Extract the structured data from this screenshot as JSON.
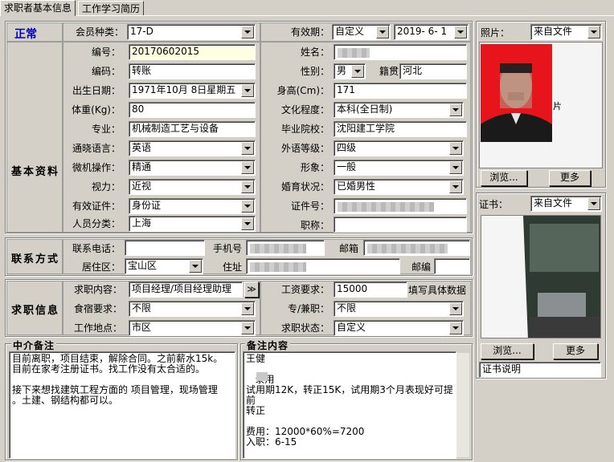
{
  "tabs": [
    "求职者基本信息",
    "工作学习简历"
  ],
  "status": "正常",
  "member_type": {
    "label": "会员种类：",
    "value": "17-D"
  },
  "validity": {
    "label": "有效期：",
    "mode": "自定义",
    "date": "2019- 6- 1"
  },
  "sections": {
    "basic": "基本资料",
    "contact": "联系方式",
    "job": "求职信息"
  },
  "basic": {
    "number_label": "编号：",
    "number": "20170602015",
    "name_label": "姓名：",
    "name": "",
    "code_label": "编码：",
    "code": "转账",
    "gender_label": "性别：",
    "gender": "男",
    "native_label": "籍贯",
    "native": "河北",
    "birth_label": "出生日期：",
    "birth": "1971年10月 8日星期五",
    "height_label": "身高(Cm)：",
    "height": "171",
    "weight_label": "体重(Kg)：",
    "weight": "80",
    "edu_label": "文化程度：",
    "edu": "本科(全日制)",
    "major_label": "专业：",
    "major": "机械制造工艺与设备",
    "school_label": "毕业院校：",
    "school": "沈阳建工学院",
    "lang_label": "通晓语言：",
    "lang": "英语",
    "lang_level_label": "外语等级：",
    "lang_level": "四级",
    "computer_label": "微机操作：",
    "computer": "精通",
    "image_label": "形象：",
    "image": "一般",
    "vision_label": "视力：",
    "vision": "近视",
    "marital_label": "婚育状况：",
    "marital": "已婚男性",
    "id_type_label": "有效证件：",
    "id_type": "身份证",
    "id_no_label": "证件号：",
    "id_no": "",
    "category_label": "人员分类：",
    "category": "上海",
    "title_label": "职称：",
    "title": ""
  },
  "contact": {
    "phone_label": "联系电话：",
    "phone": "",
    "mobile_label": "手机号",
    "mobile": "",
    "email_label": "邮箱",
    "email": "",
    "district_label": "居住区：",
    "district": "宝山区",
    "address_label": "住址",
    "address": "",
    "zip_label": "邮编",
    "zip": ""
  },
  "job": {
    "content_label": "求职内容：",
    "content": "项目经理/项目经理助理",
    "more_btn": "≫",
    "salary_label": "工资要求：",
    "salary": "15000",
    "salary_hint": "填写具体数据",
    "board_label": "食宿要求：",
    "board": "不限",
    "parttime_label": "专/兼职：",
    "parttime": "不限",
    "location_label": "工作地点：",
    "location": "市区",
    "state_label": "求职状态：",
    "state": "自定义"
  },
  "agent_note": {
    "title": "中介备注",
    "text": "目前离职，项目结束，解除合同。之前薪水15k。\n目前在家考注册证书。找工作没有太合适的。\n\n接下来想找建筑工程方面的 项目管理，现场管理\n。土建、钢结构都可以。"
  },
  "remarks": {
    "title": "备注内容",
    "text": "王健\n\n   录用\n试用期12K，转正15K，试用期3个月表现好可提前\n转正\n\n费用：12000*60%=7200\n入职：6-15"
  },
  "photo": {
    "label": "照片：",
    "source": "来自文件",
    "browse": "浏览...",
    "more": "更多"
  },
  "cert": {
    "label": "证书：",
    "source": "来自文件",
    "browse": "浏览...",
    "more": "更多",
    "desc": "证书说明"
  },
  "colors": {
    "photo_bg": "#e8141c",
    "status_text": "#0000c0"
  }
}
